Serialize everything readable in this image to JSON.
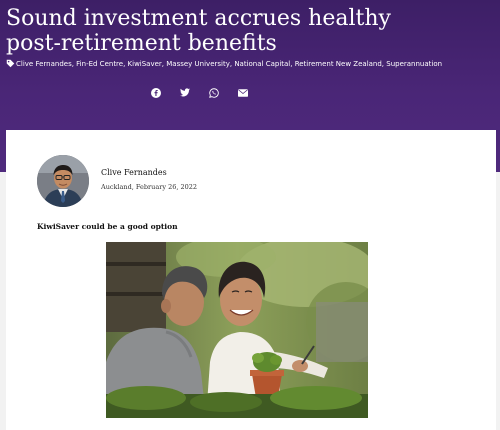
{
  "article": {
    "title": "Sound investment accrues healthy post-retirement benefits",
    "tags": "Clive Fernandes, Fin-Ed Centre, KiwiSaver, Massey University, National Capital, Retirement New Zealand, Superannuation",
    "share_icons": [
      "facebook-icon",
      "twitter-icon",
      "whatsapp-icon",
      "email-icon"
    ],
    "author": {
      "name": "Clive Fernandes",
      "meta": "Auckland, February 26, 2022"
    },
    "lead": "KiwiSaver could be a good option"
  },
  "colors": {
    "hero_top": "#3d1f66",
    "hero_bottom": "#4f2a7d",
    "card": "#ffffff"
  }
}
